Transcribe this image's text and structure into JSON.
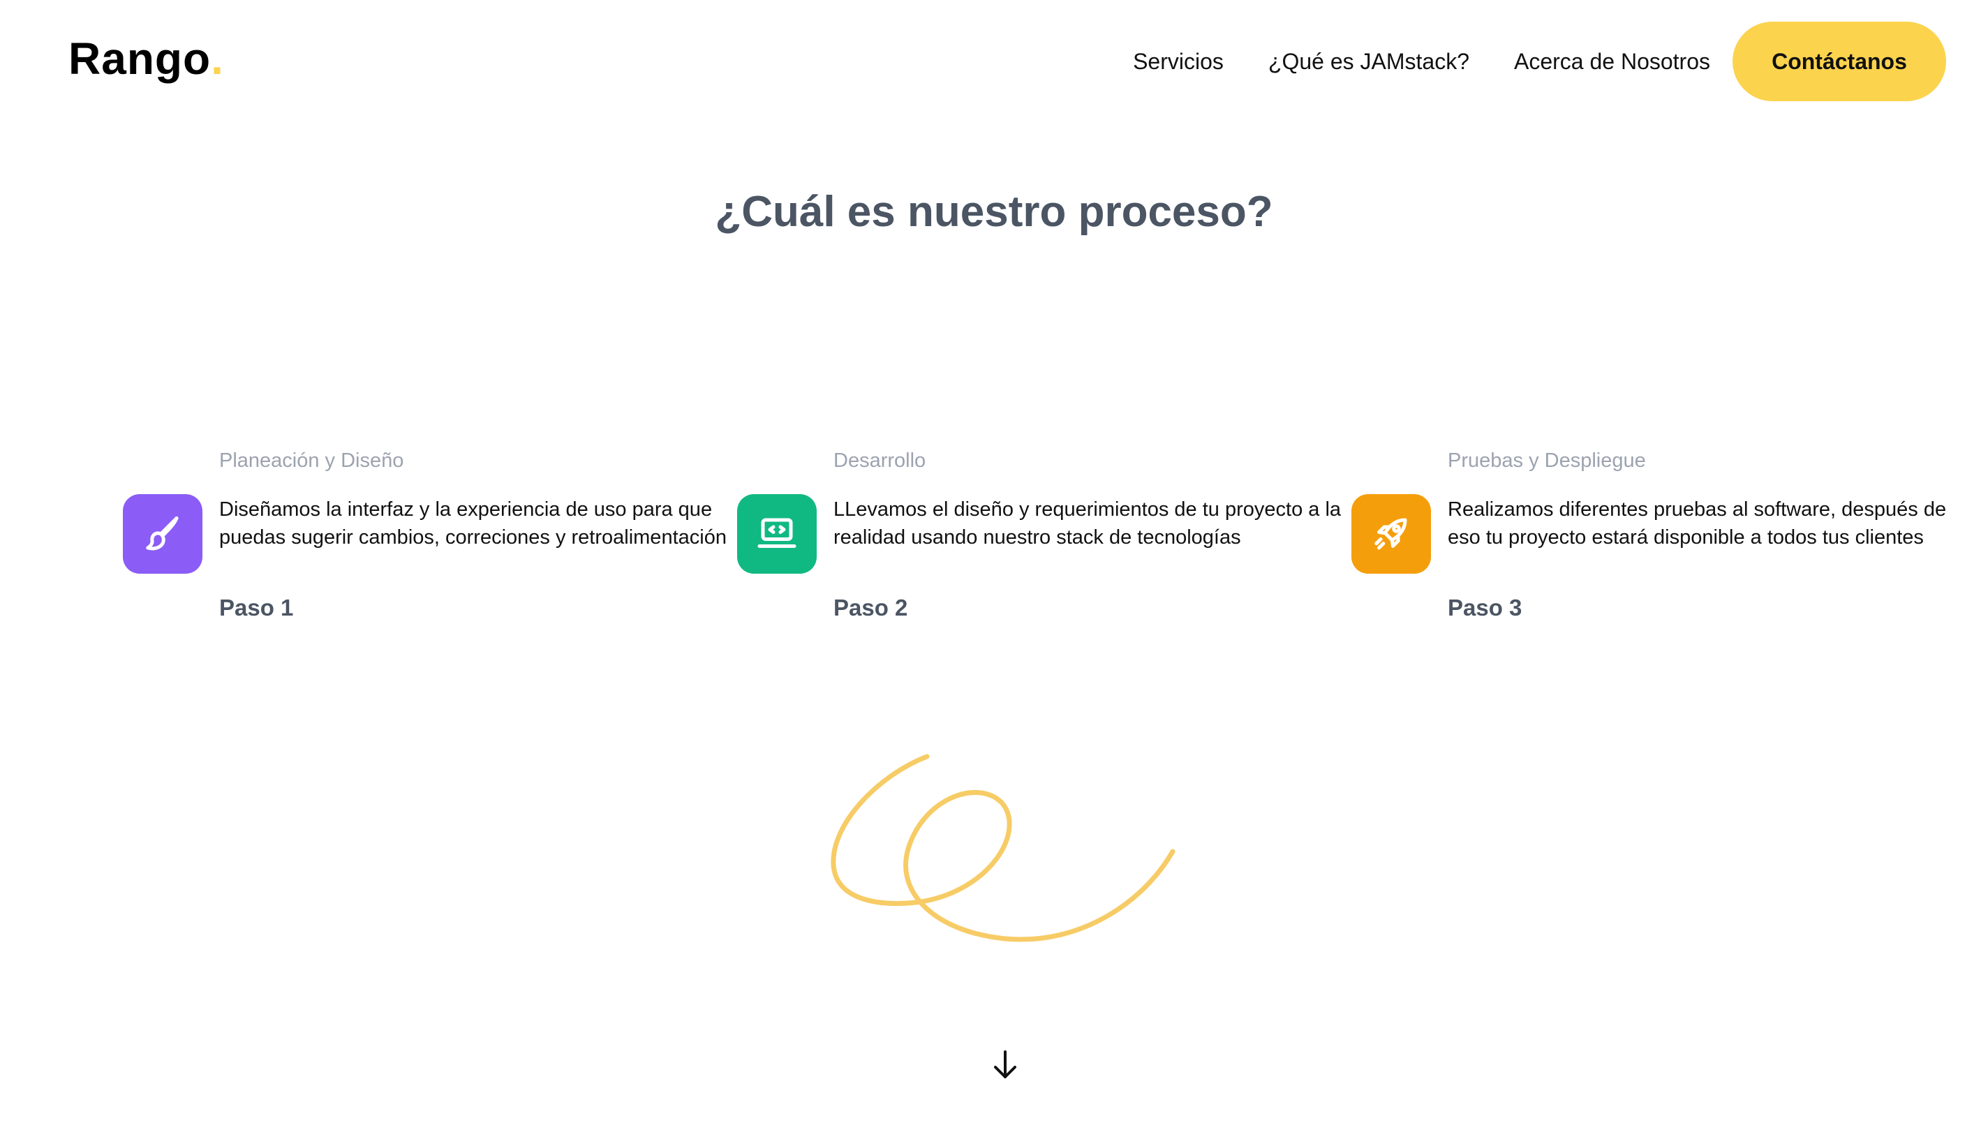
{
  "header": {
    "logo_text": "Rango",
    "logo_dot": ".",
    "nav": [
      {
        "label": "Servicios"
      },
      {
        "label": "¿Qué es JAMstack?"
      },
      {
        "label": "Acerca de Nosotros"
      }
    ],
    "cta_label": "Contáctanos"
  },
  "colors": {
    "accent": "#fcd34d",
    "step1_icon_bg": "#8b5cf6",
    "step2_icon_bg": "#10b981",
    "step3_icon_bg": "#f59e0b",
    "title_gray": "#4b5563",
    "category_gray": "#9ca3af"
  },
  "process": {
    "title": "¿Cuál es nuestro proceso?",
    "steps": [
      {
        "category": "Planeación y Diseño",
        "description": "Diseñamos la interfaz y la experiencia de uso para que puedas sugerir cambios, correciones y retroalimentación",
        "label": "Paso 1",
        "icon": "paintbrush-icon"
      },
      {
        "category": "Desarrollo",
        "description": "LLevamos el diseño y requerimientos de tu proyecto a la realidad usando nuestro stack de tecnologías",
        "label": "Paso 2",
        "icon": "laptop-code-icon"
      },
      {
        "category": "Pruebas y Despliegue",
        "description": "Realizamos diferentes pruebas al software, después de eso tu proyecto estará disponible a todos tus clientes",
        "label": "Paso 3",
        "icon": "rocket-icon"
      }
    ]
  },
  "scroll": {
    "icon": "arrow-down-icon"
  }
}
